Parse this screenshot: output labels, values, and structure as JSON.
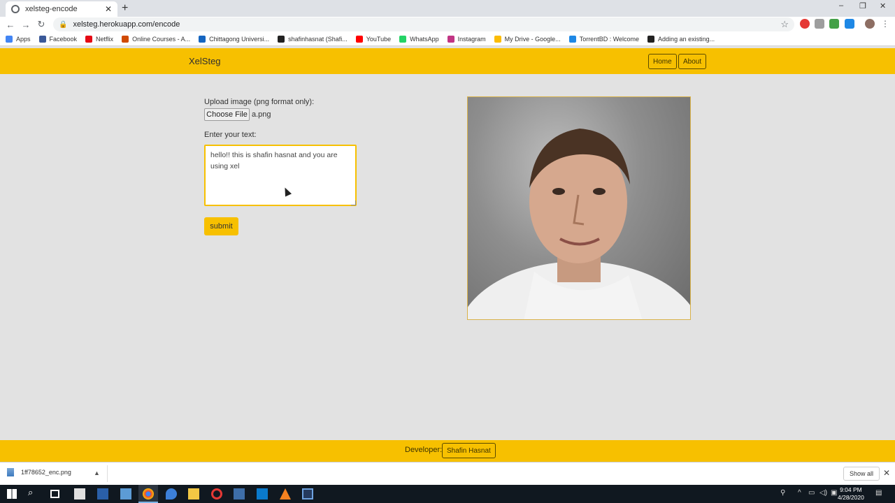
{
  "browser": {
    "tab_title": "xelsteg-encode",
    "tab_close": "✕",
    "new_tab": "+",
    "url": "xelsteg.herokuapp.com/encode",
    "window_controls": {
      "minimize": "–",
      "restore": "❐",
      "close": "✕"
    },
    "bookmarks": [
      {
        "label": "Apps",
        "color": "#4285f4"
      },
      {
        "label": "Facebook",
        "color": "#3b5998"
      },
      {
        "label": "Netflix",
        "color": "#e50914"
      },
      {
        "label": "Online Courses - A...",
        "color": "#d04a02"
      },
      {
        "label": "Chittagong Universi...",
        "color": "#1565c0"
      },
      {
        "label": "shafinhasnat (Shafi...",
        "color": "#222222"
      },
      {
        "label": "YouTube",
        "color": "#ff0000"
      },
      {
        "label": "WhatsApp",
        "color": "#25d366"
      },
      {
        "label": "Instagram",
        "color": "#c13584"
      },
      {
        "label": "My Drive - Google...",
        "color": "#fbbc04"
      },
      {
        "label": "TorrentBD : Welcome",
        "color": "#1e88e5"
      },
      {
        "label": "Adding an existing...",
        "color": "#222222"
      }
    ]
  },
  "navbar": {
    "brand": "XelSteg",
    "home_label": "Home",
    "about_label": "About"
  },
  "form": {
    "upload_label": "Upload image (png format only):",
    "choose_file_label": "Choose File",
    "file_name": "a.png",
    "text_label": "Enter your text:",
    "text_value": "hello!! this is shafin hasnat and you are using xel",
    "submit_label": "submit"
  },
  "footer": {
    "developer_label": "Developer:",
    "developer_name": "Shafin Hasnat"
  },
  "downloads": {
    "file": "1ff78652_enc.png",
    "show_all": "Show all"
  },
  "taskbar": {
    "time": "9:04 PM",
    "date": "4/28/2020"
  },
  "colors": {
    "accent": "#f7c000",
    "page_bg": "#e2e2e2"
  }
}
